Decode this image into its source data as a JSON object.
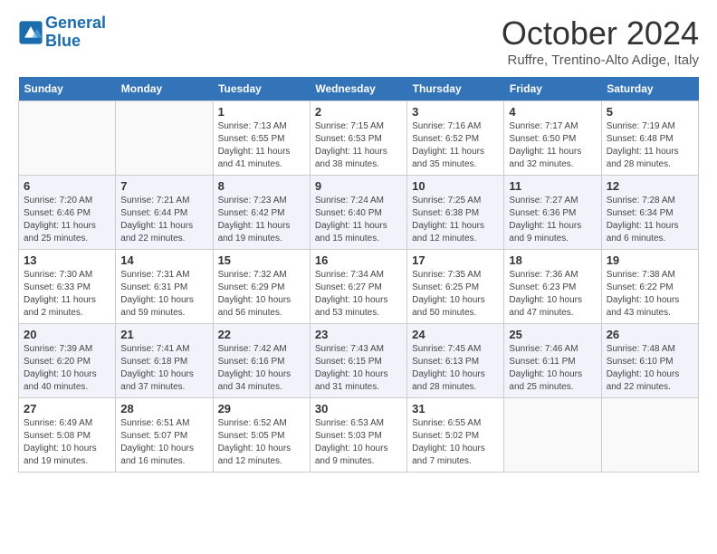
{
  "header": {
    "logo_line1": "General",
    "logo_line2": "Blue",
    "month": "October 2024",
    "location": "Ruffre, Trentino-Alto Adige, Italy"
  },
  "days_of_week": [
    "Sunday",
    "Monday",
    "Tuesday",
    "Wednesday",
    "Thursday",
    "Friday",
    "Saturday"
  ],
  "weeks": [
    [
      {
        "num": "",
        "info": ""
      },
      {
        "num": "",
        "info": ""
      },
      {
        "num": "1",
        "info": "Sunrise: 7:13 AM\nSunset: 6:55 PM\nDaylight: 11 hours and 41 minutes."
      },
      {
        "num": "2",
        "info": "Sunrise: 7:15 AM\nSunset: 6:53 PM\nDaylight: 11 hours and 38 minutes."
      },
      {
        "num": "3",
        "info": "Sunrise: 7:16 AM\nSunset: 6:52 PM\nDaylight: 11 hours and 35 minutes."
      },
      {
        "num": "4",
        "info": "Sunrise: 7:17 AM\nSunset: 6:50 PM\nDaylight: 11 hours and 32 minutes."
      },
      {
        "num": "5",
        "info": "Sunrise: 7:19 AM\nSunset: 6:48 PM\nDaylight: 11 hours and 28 minutes."
      }
    ],
    [
      {
        "num": "6",
        "info": "Sunrise: 7:20 AM\nSunset: 6:46 PM\nDaylight: 11 hours and 25 minutes."
      },
      {
        "num": "7",
        "info": "Sunrise: 7:21 AM\nSunset: 6:44 PM\nDaylight: 11 hours and 22 minutes."
      },
      {
        "num": "8",
        "info": "Sunrise: 7:23 AM\nSunset: 6:42 PM\nDaylight: 11 hours and 19 minutes."
      },
      {
        "num": "9",
        "info": "Sunrise: 7:24 AM\nSunset: 6:40 PM\nDaylight: 11 hours and 15 minutes."
      },
      {
        "num": "10",
        "info": "Sunrise: 7:25 AM\nSunset: 6:38 PM\nDaylight: 11 hours and 12 minutes."
      },
      {
        "num": "11",
        "info": "Sunrise: 7:27 AM\nSunset: 6:36 PM\nDaylight: 11 hours and 9 minutes."
      },
      {
        "num": "12",
        "info": "Sunrise: 7:28 AM\nSunset: 6:34 PM\nDaylight: 11 hours and 6 minutes."
      }
    ],
    [
      {
        "num": "13",
        "info": "Sunrise: 7:30 AM\nSunset: 6:33 PM\nDaylight: 11 hours and 2 minutes."
      },
      {
        "num": "14",
        "info": "Sunrise: 7:31 AM\nSunset: 6:31 PM\nDaylight: 10 hours and 59 minutes."
      },
      {
        "num": "15",
        "info": "Sunrise: 7:32 AM\nSunset: 6:29 PM\nDaylight: 10 hours and 56 minutes."
      },
      {
        "num": "16",
        "info": "Sunrise: 7:34 AM\nSunset: 6:27 PM\nDaylight: 10 hours and 53 minutes."
      },
      {
        "num": "17",
        "info": "Sunrise: 7:35 AM\nSunset: 6:25 PM\nDaylight: 10 hours and 50 minutes."
      },
      {
        "num": "18",
        "info": "Sunrise: 7:36 AM\nSunset: 6:23 PM\nDaylight: 10 hours and 47 minutes."
      },
      {
        "num": "19",
        "info": "Sunrise: 7:38 AM\nSunset: 6:22 PM\nDaylight: 10 hours and 43 minutes."
      }
    ],
    [
      {
        "num": "20",
        "info": "Sunrise: 7:39 AM\nSunset: 6:20 PM\nDaylight: 10 hours and 40 minutes."
      },
      {
        "num": "21",
        "info": "Sunrise: 7:41 AM\nSunset: 6:18 PM\nDaylight: 10 hours and 37 minutes."
      },
      {
        "num": "22",
        "info": "Sunrise: 7:42 AM\nSunset: 6:16 PM\nDaylight: 10 hours and 34 minutes."
      },
      {
        "num": "23",
        "info": "Sunrise: 7:43 AM\nSunset: 6:15 PM\nDaylight: 10 hours and 31 minutes."
      },
      {
        "num": "24",
        "info": "Sunrise: 7:45 AM\nSunset: 6:13 PM\nDaylight: 10 hours and 28 minutes."
      },
      {
        "num": "25",
        "info": "Sunrise: 7:46 AM\nSunset: 6:11 PM\nDaylight: 10 hours and 25 minutes."
      },
      {
        "num": "26",
        "info": "Sunrise: 7:48 AM\nSunset: 6:10 PM\nDaylight: 10 hours and 22 minutes."
      }
    ],
    [
      {
        "num": "27",
        "info": "Sunrise: 6:49 AM\nSunset: 5:08 PM\nDaylight: 10 hours and 19 minutes."
      },
      {
        "num": "28",
        "info": "Sunrise: 6:51 AM\nSunset: 5:07 PM\nDaylight: 10 hours and 16 minutes."
      },
      {
        "num": "29",
        "info": "Sunrise: 6:52 AM\nSunset: 5:05 PM\nDaylight: 10 hours and 12 minutes."
      },
      {
        "num": "30",
        "info": "Sunrise: 6:53 AM\nSunset: 5:03 PM\nDaylight: 10 hours and 9 minutes."
      },
      {
        "num": "31",
        "info": "Sunrise: 6:55 AM\nSunset: 5:02 PM\nDaylight: 10 hours and 7 minutes."
      },
      {
        "num": "",
        "info": ""
      },
      {
        "num": "",
        "info": ""
      }
    ]
  ]
}
